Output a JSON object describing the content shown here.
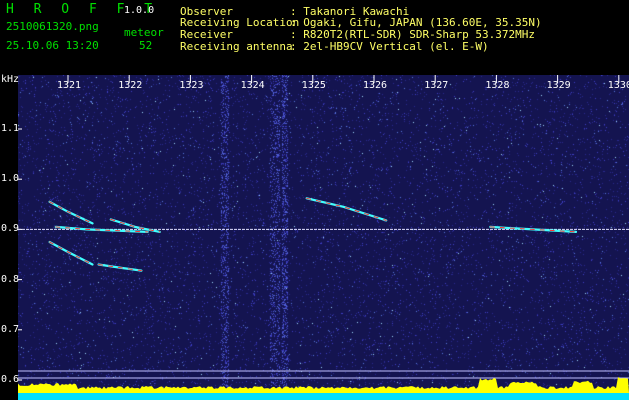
{
  "app": {
    "title": "H R O F F T",
    "version": "1.0.0"
  },
  "file": {
    "name": "2510061320.png",
    "datetime": "25.10.06 13:20"
  },
  "meteor": {
    "label": "meteor",
    "count": "52"
  },
  "info": [
    {
      "label": "Observer",
      "value": ": Takanori Kawachi"
    },
    {
      "label": "Receiving Location",
      "value": ": Ogaki, Gifu, JAPAN (136.60E, 35.35N)"
    },
    {
      "label": "Receiver",
      "value": ": R820T2(RTL-SDR) SDR-Sharp 53.372MHz"
    },
    {
      "label": "Receiving antenna",
      "value": ": 2el-HB9CV Vertical (el. E-W)"
    }
  ],
  "axis": {
    "y_unit": "kHz",
    "y_ticks": [
      "1.1",
      "1.0",
      "0.9",
      "0.8",
      "0.7",
      "0.6"
    ],
    "x_ticks": [
      "1321",
      "1322",
      "1323",
      "1324",
      "1325",
      "1326",
      "1327",
      "1328",
      "1329",
      "1330"
    ]
  },
  "chart_data": {
    "type": "heatmap",
    "ylabel": "kHz",
    "ylim": [
      0.58,
      1.2
    ],
    "xlim": [
      1320.6,
      1330.2
    ],
    "carrier_khz": 0.9,
    "colors": {
      "background": "#141450",
      "carrier": "#e0e0ff",
      "trace_hot": "#ff3030",
      "trace": "#40ffff",
      "bottom_bar": "#ffff00",
      "bottom_base": "#00e0ff"
    },
    "meteor_traces": [
      {
        "x": [
          1320.7,
          1321.0,
          1321.4
        ],
        "y": [
          0.955,
          0.935,
          0.912
        ]
      },
      {
        "x": [
          1320.8,
          1321.3,
          1322.3
        ],
        "y": [
          0.905,
          0.9,
          0.895
        ]
      },
      {
        "x": [
          1320.7,
          1321.0,
          1321.4
        ],
        "y": [
          0.875,
          0.855,
          0.83
        ]
      },
      {
        "x": [
          1321.5,
          1321.9,
          1322.2
        ],
        "y": [
          0.83,
          0.823,
          0.818
        ]
      },
      {
        "x": [
          1321.7,
          1322.1,
          1322.5
        ],
        "y": [
          0.92,
          0.905,
          0.895
        ]
      },
      {
        "x": [
          1324.9,
          1325.5,
          1326.2
        ],
        "y": [
          0.962,
          0.945,
          0.918
        ]
      },
      {
        "x": [
          1327.9,
          1328.6,
          1329.3
        ],
        "y": [
          0.905,
          0.9,
          0.895
        ]
      }
    ]
  }
}
